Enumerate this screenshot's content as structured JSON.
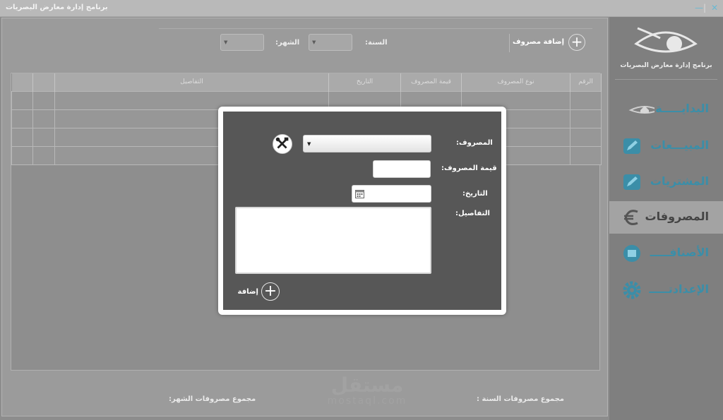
{
  "window": {
    "title": "برنامج إدارة معارض البصريات",
    "close_glyph": "✕",
    "min_glyph": "—",
    "sep_glyph": "|"
  },
  "sidebar": {
    "logo_text": "برنامج إدارة معارض البصريات",
    "items": [
      {
        "label": "البدايـــــة",
        "icon": "home-eye-icon",
        "active": false
      },
      {
        "label": "المبيـــعات",
        "icon": "pencil-icon",
        "active": false
      },
      {
        "label": "المشتريات",
        "icon": "pencil-icon",
        "active": false
      },
      {
        "label": "المصروفات",
        "icon": "euro-icon",
        "active": true
      },
      {
        "label": "الأصنافـــــ",
        "icon": "box-icon",
        "active": false
      },
      {
        "label": "الإعدادتـــــ",
        "icon": "gear-icon",
        "active": false
      }
    ]
  },
  "toolbar": {
    "add_expense_label": "إضافة مصروف",
    "add_glyph": "+",
    "year_label": "السنة:",
    "month_label": "الشهر:",
    "combo_arrow": "▼"
  },
  "table": {
    "columns": [
      "الرقم",
      "نوع المصروف",
      "قيمة المصروف",
      "التاريخ",
      "التفاصيل",
      "",
      ""
    ],
    "row_count": 4
  },
  "footer": {
    "year_total_label": "مجموع مصروفات السنة :",
    "month_total_label": "مجموع مصروفات الشهر:",
    "watermark_line1": "مستقل",
    "watermark_line2": "mostaql.com"
  },
  "dialog": {
    "expense_label": "المصروف:",
    "amount_label": "قيمة المصروف:",
    "date_label": "التاريخ:",
    "details_label": "التفاصيل:",
    "add_label": "إضافة",
    "add_glyph": "+",
    "combo_arrow": "▼",
    "expense_value": "",
    "amount_value": "",
    "date_value": "",
    "details_value": ""
  },
  "colors": {
    "accent": "#3b8ea8",
    "dialog_bg": "#575757"
  }
}
